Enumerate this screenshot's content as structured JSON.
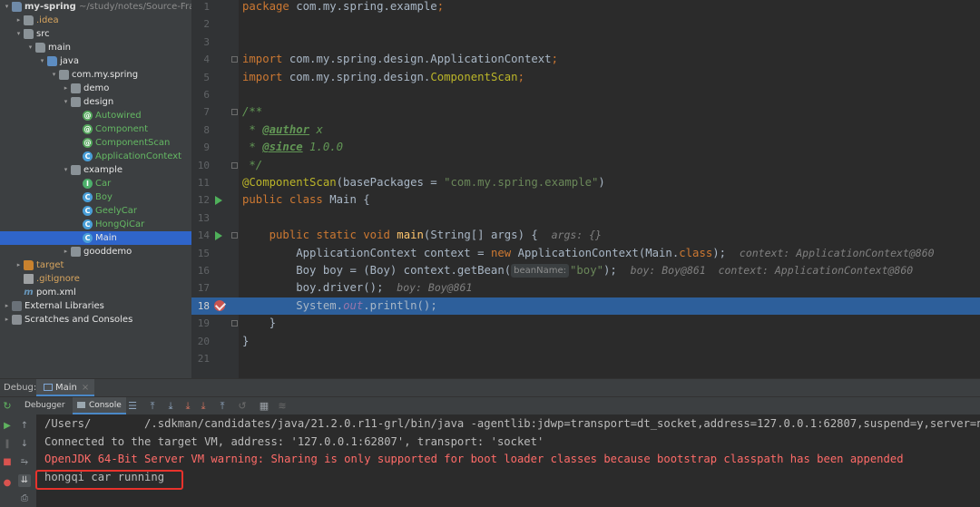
{
  "project": {
    "name": "my-spring",
    "path": "~/study/notes/Source-Fram",
    "tree": [
      {
        "label": "my-spring",
        "indent": 0,
        "arrow": "▾",
        "icon": "folder module",
        "cls": "lbl-mod",
        "name": "tree-item-my-spring",
        "extra": "~/study/notes/Source-Fram"
      },
      {
        "label": ".idea",
        "indent": 1,
        "arrow": "▸",
        "icon": "folder",
        "cls": "lbl-orange",
        "name": "tree-item-idea"
      },
      {
        "label": "src",
        "indent": 1,
        "arrow": "▾",
        "icon": "folder",
        "cls": "lbl-white",
        "name": "tree-item-src"
      },
      {
        "label": "main",
        "indent": 2,
        "arrow": "▾",
        "icon": "folder",
        "cls": "lbl-white",
        "name": "tree-item-main"
      },
      {
        "label": "java",
        "indent": 3,
        "arrow": "▾",
        "icon": "folder src",
        "cls": "lbl-white",
        "name": "tree-item-java"
      },
      {
        "label": "com.my.spring",
        "indent": 4,
        "arrow": "▾",
        "icon": "pkg",
        "cls": "lbl-white",
        "name": "tree-item-com-my-spring"
      },
      {
        "label": "demo",
        "indent": 5,
        "arrow": "▸",
        "icon": "pkg",
        "cls": "lbl-white",
        "name": "tree-item-demo"
      },
      {
        "label": "design",
        "indent": 5,
        "arrow": "▾",
        "icon": "pkg",
        "cls": "lbl-white",
        "name": "tree-item-design"
      },
      {
        "label": "Autowired",
        "indent": 6,
        "arrow": "",
        "icon": "cls-a",
        "glyph": "@",
        "cls": "lbl-green",
        "name": "tree-item-autowired"
      },
      {
        "label": "Component",
        "indent": 6,
        "arrow": "",
        "icon": "cls-a",
        "glyph": "@",
        "cls": "lbl-green",
        "name": "tree-item-component"
      },
      {
        "label": "ComponentScan",
        "indent": 6,
        "arrow": "",
        "icon": "cls-a",
        "glyph": "@",
        "cls": "lbl-green",
        "name": "tree-item-componentscan"
      },
      {
        "label": "ApplicationContext",
        "indent": 6,
        "arrow": "",
        "icon": "cls-c",
        "glyph": "C",
        "cls": "lbl-green",
        "name": "tree-item-applicationcontext"
      },
      {
        "label": "example",
        "indent": 5,
        "arrow": "▾",
        "icon": "pkg",
        "cls": "lbl-white",
        "name": "tree-item-example"
      },
      {
        "label": "Car",
        "indent": 6,
        "arrow": "",
        "icon": "cls-i",
        "glyph": "I",
        "cls": "lbl-green",
        "name": "tree-item-car"
      },
      {
        "label": "Boy",
        "indent": 6,
        "arrow": "",
        "icon": "cls-c",
        "glyph": "C",
        "cls": "lbl-green",
        "name": "tree-item-boy"
      },
      {
        "label": "GeelyCar",
        "indent": 6,
        "arrow": "",
        "icon": "cls-c",
        "glyph": "C",
        "cls": "lbl-green",
        "name": "tree-item-geelycar"
      },
      {
        "label": "HongQiCar",
        "indent": 6,
        "arrow": "",
        "icon": "cls-c",
        "glyph": "C",
        "cls": "lbl-green",
        "name": "tree-item-hongqicar"
      },
      {
        "label": "Main",
        "indent": 6,
        "arrow": "",
        "icon": "cls-c",
        "glyph": "C",
        "cls": "lbl-white",
        "name": "tree-item-main-class",
        "selected": true
      },
      {
        "label": "gooddemo",
        "indent": 5,
        "arrow": "▸",
        "icon": "pkg",
        "cls": "lbl-white",
        "name": "tree-item-gooddemo"
      },
      {
        "label": "target",
        "indent": 1,
        "arrow": "▸",
        "icon": "folder orange",
        "cls": "lbl-orange",
        "name": "tree-item-target"
      },
      {
        "label": ".gitignore",
        "indent": 1,
        "arrow": "",
        "icon": "fileic",
        "cls": "lbl-ign",
        "name": "tree-item-gitignore"
      },
      {
        "label": "pom.xml",
        "indent": 1,
        "arrow": "",
        "icon": "mvn",
        "glyph": "m",
        "cls": "lbl-white",
        "name": "tree-item-pom-xml"
      },
      {
        "label": "External Libraries",
        "indent": 0,
        "arrow": "▸",
        "icon": "libs",
        "cls": "lbl-white",
        "name": "tree-item-external-libraries"
      },
      {
        "label": "Scratches and Consoles",
        "indent": 0,
        "arrow": "▸",
        "icon": "scr",
        "cls": "lbl-white",
        "name": "tree-item-scratches"
      }
    ]
  },
  "editor": {
    "line_numbers": [
      "1",
      "2",
      "3",
      "4",
      "5",
      "6",
      "7",
      "8",
      "9",
      "10",
      "11",
      "12",
      "13",
      "14",
      "15",
      "16",
      "17",
      "18",
      "19",
      "20",
      "21"
    ],
    "highlight_line": "18",
    "code": {
      "l1": [
        [
          "kw",
          "package "
        ],
        [
          "",
          "com.my.spring.example"
        ],
        [
          "kw",
          ";"
        ]
      ],
      "l4": [
        [
          "kw",
          "import "
        ],
        [
          "",
          "com.my.spring.design.ApplicationContext"
        ],
        [
          "kw",
          ";"
        ]
      ],
      "l5": [
        [
          "kw",
          "import "
        ],
        [
          "",
          "com.my.spring.design."
        ],
        [
          "an",
          "ComponentScan"
        ],
        [
          "kw",
          ";"
        ]
      ],
      "l7": [
        [
          "cm",
          "/**"
        ]
      ],
      "l8": [
        [
          "cm",
          " * "
        ],
        [
          "doct",
          "@author"
        ],
        [
          "cm",
          " x"
        ]
      ],
      "l9": [
        [
          "cm",
          " * "
        ],
        [
          "doct",
          "@since"
        ],
        [
          "cm",
          " 1.0.0"
        ]
      ],
      "l10": [
        [
          "cm",
          " */"
        ]
      ],
      "l11": [
        [
          "an",
          "@ComponentScan"
        ],
        [
          "",
          "(basePackages = "
        ],
        [
          "st",
          "\"com.my.spring.example\""
        ],
        [
          "",
          ")"
        ]
      ],
      "l12": [
        [
          "kw",
          "public class "
        ],
        [
          "",
          "Main {"
        ]
      ],
      "l14": [
        [
          "",
          "    "
        ],
        [
          "kw",
          "public static void "
        ],
        [
          "fn",
          "main"
        ],
        [
          "",
          "(String[] args) {  "
        ],
        [
          "hint",
          "args: {}"
        ]
      ],
      "l15": [
        [
          "",
          "        ApplicationContext context = "
        ],
        [
          "kw",
          "new "
        ],
        [
          "",
          "ApplicationContext(Main."
        ],
        [
          "kw",
          "class"
        ],
        [
          "",
          ");  "
        ],
        [
          "hint",
          "context: ApplicationContext@860"
        ]
      ],
      "l16": [
        [
          "",
          "        Boy boy = (Boy) context.getBean("
        ],
        [
          "param",
          "beanName:"
        ],
        [
          "st",
          "\"boy\""
        ],
        [
          "",
          ");  "
        ],
        [
          "hint",
          "boy: Boy@861  context: ApplicationContext@860"
        ]
      ],
      "l17": [
        [
          "",
          "        boy.driver();  "
        ],
        [
          "hint",
          "boy: Boy@861"
        ]
      ],
      "l18": [
        [
          "",
          "        System."
        ],
        [
          "fld",
          "out"
        ],
        [
          "",
          ".println();"
        ]
      ],
      "l19": [
        [
          "",
          "    }"
        ]
      ],
      "l20": [
        [
          "",
          "}"
        ]
      ]
    }
  },
  "debug": {
    "label": "Debug:",
    "config_tab": "Main",
    "tabs": {
      "debugger": "Debugger",
      "console": "Console"
    },
    "console_lines": [
      {
        "text": "/Users/        /.sdkman/candidates/java/21.2.0.r11-grl/bin/java -agentlib:jdwp=transport=dt_socket,address=127.0.0.1:62807,suspend=y,server=n",
        "err": false
      },
      {
        "text": "Connected to the target VM, address: '127.0.0.1:62807', transport: 'socket'",
        "err": false
      },
      {
        "text": "OpenJDK 64-Bit Server VM warning: Sharing is only supported for boot loader classes because bootstrap classpath has been appended",
        "err": true
      },
      {
        "text": "hongqi car running",
        "err": false
      }
    ]
  },
  "colors": {
    "selection": "#2d5f9b",
    "tree_bg": "#3c3f41",
    "editor_bg": "#2b2b2b",
    "annotation_box": "#e8322c"
  }
}
